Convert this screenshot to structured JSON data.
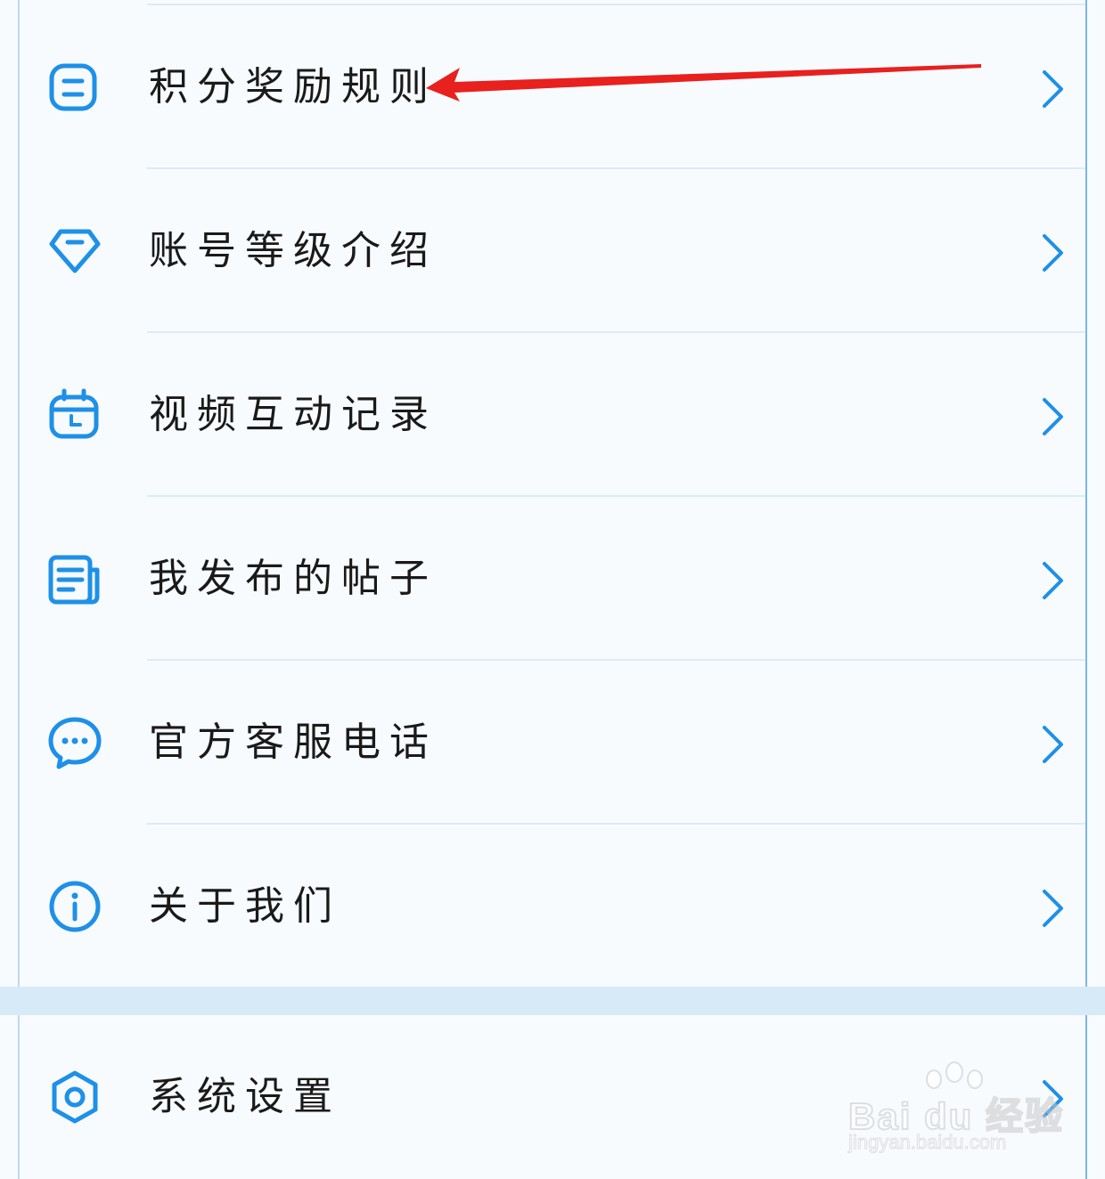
{
  "menu": {
    "items": [
      {
        "label": "积分奖励规则",
        "icon": "document-list-icon"
      },
      {
        "label": "账号等级介绍",
        "icon": "diamond-icon"
      },
      {
        "label": "视频互动记录",
        "icon": "calendar-icon"
      },
      {
        "label": "我发布的帖子",
        "icon": "article-icon"
      },
      {
        "label": "官方客服电话",
        "icon": "chat-bubble-icon"
      },
      {
        "label": "关于我们",
        "icon": "info-icon"
      }
    ]
  },
  "settings": {
    "label": "系统设置",
    "icon": "settings-hexagon-icon"
  },
  "watermark": {
    "brand": "Bai du 经验",
    "url": "jingyan.baidu.com"
  },
  "colors": {
    "accent": "#1e90e8",
    "annotation_arrow": "#e8201e",
    "section_gap": "#d6eaf8"
  }
}
